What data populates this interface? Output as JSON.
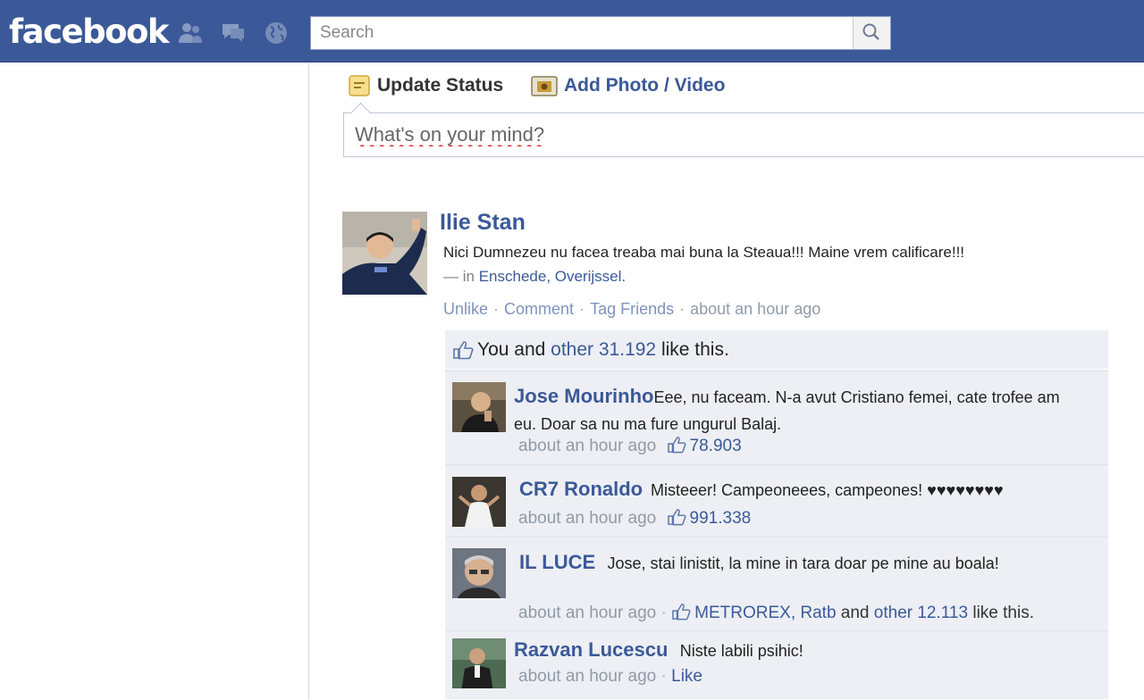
{
  "header": {
    "logo": "facebook",
    "search": {
      "placeholder": "Search"
    },
    "icons": [
      "friends-icon",
      "messages-icon",
      "notifications-icon",
      "search-icon"
    ]
  },
  "composer": {
    "update_status": "Update Status",
    "add_photo": "Add Photo / Video",
    "placeholder": "What's on your mind?"
  },
  "post": {
    "author": "Ilie Stan",
    "text": "Nici Dumnezeu nu facea treaba mai buna la Steaua!!! Maine vrem calificare!!!",
    "location_prefix": "— in",
    "location": "Enschede, Overijssel.",
    "actions": {
      "unlike": "Unlike",
      "comment": "Comment",
      "tag": "Tag Friends",
      "time": "about an hour ago"
    },
    "likes": {
      "you_and": "You and",
      "other": "other",
      "count": "31.192",
      "suffix": "like this."
    }
  },
  "comments": [
    {
      "name": "Jose Mourinho",
      "text": "Eee, nu faceam. N-a avut Cristiano femei, cate trofee am eu. Doar sa nu ma fure ungurul Balaj.",
      "time": "about an hour ago",
      "likes": "78.903"
    },
    {
      "name": "CR7 Ronaldo",
      "text": "Misteeer! Campeoneees, campeones! ♥♥♥♥♥♥♥♥",
      "time": "about an hour ago",
      "likes": "991.338"
    },
    {
      "name": "IL LUCE",
      "text": "Jose, stai linistit, la mine in tara doar pe mine au boala!",
      "time": "about an hour ago",
      "like_names": "METROREX, Ratb",
      "and": "and",
      "other": "other 12.113",
      "suffix": "like this."
    },
    {
      "name": "Razvan Lucescu",
      "text": "Niste labili psihic!",
      "time": "about an hour ago",
      "like_action": "Like"
    }
  ],
  "colors": {
    "brand": "#3b5998",
    "ufi_bg": "#edeff4",
    "meta": "#909aa8"
  }
}
